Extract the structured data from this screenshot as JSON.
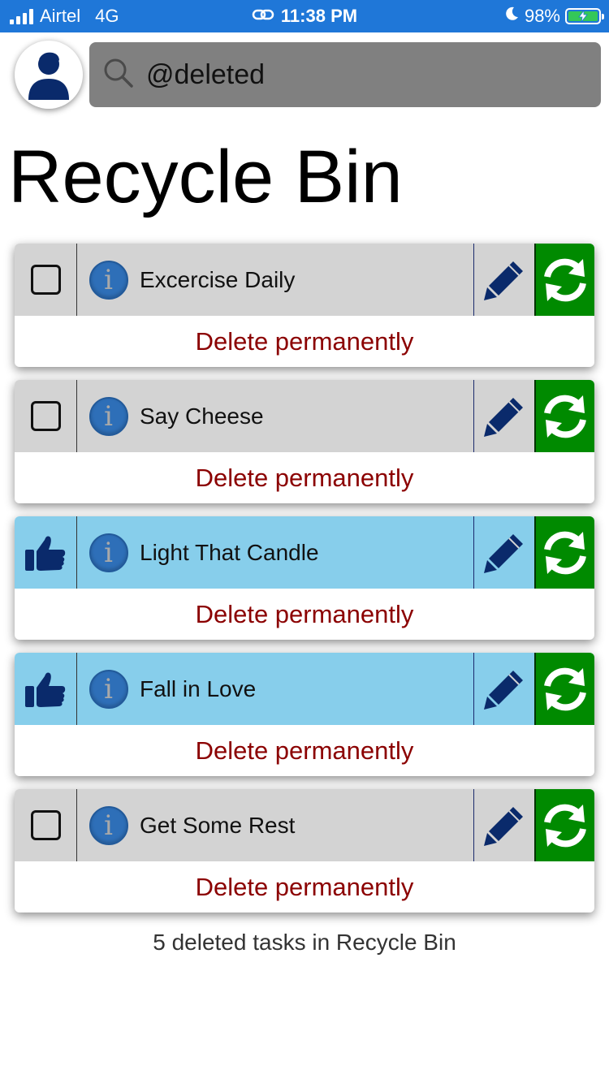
{
  "status_bar": {
    "carrier": "Airtel",
    "network": "4G",
    "time": "11:38 PM",
    "battery": "98%",
    "bg_color": "#1f77d8"
  },
  "header": {
    "avatar_icon": "user-avatar-icon",
    "search": {
      "value": "@deleted",
      "icon": "search-icon"
    }
  },
  "page_title": "Recycle Bin",
  "tasks": [
    {
      "name": "Excercise Daily",
      "state": "unchecked",
      "delete_label": "Delete permanently"
    },
    {
      "name": "Say Cheese",
      "state": "unchecked",
      "delete_label": "Delete permanently"
    },
    {
      "name": "Light That Candle",
      "state": "liked",
      "delete_label": "Delete permanently"
    },
    {
      "name": "Fall in Love",
      "state": "liked",
      "delete_label": "Delete permanently"
    },
    {
      "name": "Get Some Rest",
      "state": "unchecked",
      "delete_label": "Delete permanently"
    }
  ],
  "icons": {
    "info": "info-icon",
    "edit": "pencil-icon",
    "restore": "restore-icon",
    "like": "thumbs-up-icon"
  },
  "colors": {
    "row_default": "#d3d3d3",
    "row_liked": "#87ceeb",
    "restore_bg": "#008a00",
    "delete_text": "#8b0000",
    "icon_navy": "#0a2a6b"
  },
  "footer": "5 deleted tasks in Recycle Bin"
}
